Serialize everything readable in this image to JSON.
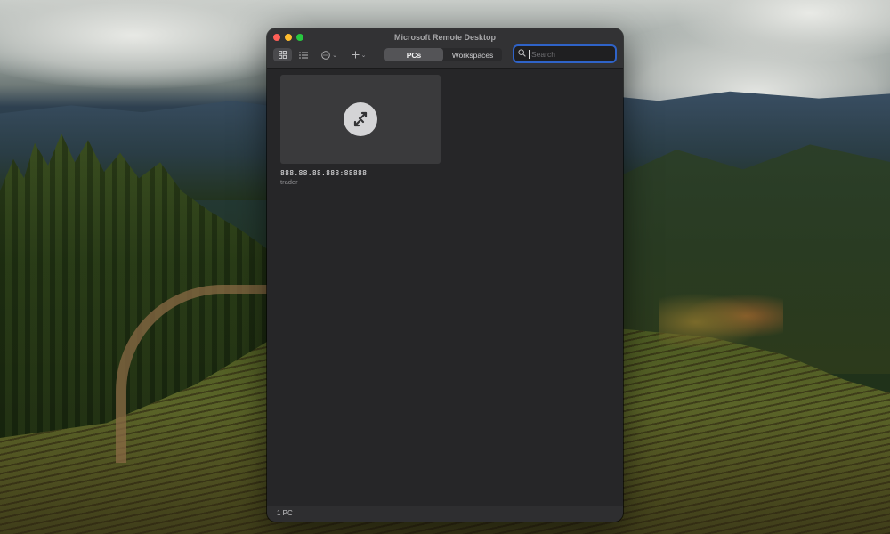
{
  "window": {
    "title": "Microsoft Remote Desktop"
  },
  "toolbar": {
    "view_grid_icon": "grid-icon",
    "view_list_icon": "list-icon",
    "more_icon": "ellipsis-circle-icon",
    "add_icon": "plus-icon",
    "tabs": [
      {
        "label": "PCs",
        "active": true
      },
      {
        "label": "Workspaces",
        "active": false
      }
    ],
    "search": {
      "placeholder": "Search",
      "value": ""
    }
  },
  "pcs": [
    {
      "name": "888.88.88.888:88888",
      "user": "trader"
    }
  ],
  "status": {
    "text": "1 PC"
  },
  "colors": {
    "accent": "#2f63c8",
    "window_bg": "#262628",
    "close": "#fe5f57",
    "minimize": "#febc2e",
    "maximize": "#28c840"
  }
}
